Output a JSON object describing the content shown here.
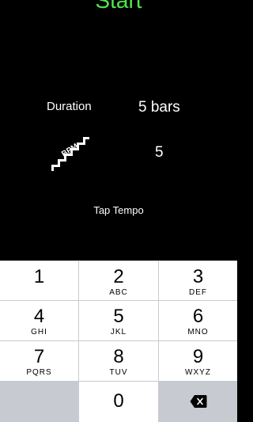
{
  "start_label": "Start",
  "duration": {
    "label": "Duration",
    "value": "5 bars"
  },
  "bpm": {
    "icon_text": "BPM",
    "value": "5"
  },
  "tap_tempo_label": "Tap Tempo",
  "keypad": {
    "keys": [
      {
        "digit": "1",
        "letters": ""
      },
      {
        "digit": "2",
        "letters": "ABC"
      },
      {
        "digit": "3",
        "letters": "DEF"
      },
      {
        "digit": "4",
        "letters": "GHI"
      },
      {
        "digit": "5",
        "letters": "JKL"
      },
      {
        "digit": "6",
        "letters": "MNO"
      },
      {
        "digit": "7",
        "letters": "PQRS"
      },
      {
        "digit": "8",
        "letters": "TUV"
      },
      {
        "digit": "9",
        "letters": "WXYZ"
      }
    ],
    "zero": "0",
    "backspace_icon": "backspace-icon"
  },
  "colors": {
    "start": "#4ee54e",
    "keyboard_bg": "#c7cbd1",
    "key_bg": "#ffffff"
  }
}
